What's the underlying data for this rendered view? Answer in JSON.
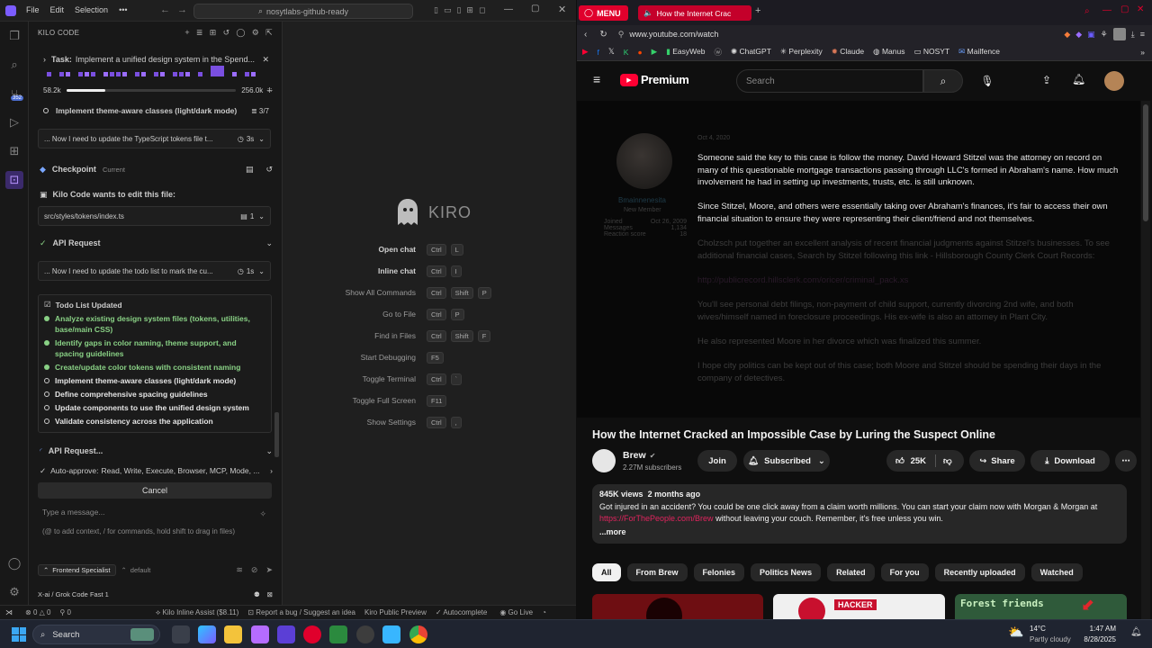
{
  "ide": {
    "menu": [
      "File",
      "Edit",
      "Selection"
    ],
    "search": "nosytlabs-github-ready",
    "panel_title": "KILO CODE",
    "task_label": "Task:",
    "task_text": "Implement a unified design system in the Spend...",
    "tokens_left": "58.2k",
    "tokens_right": "256.0k",
    "current_todo": "Implement theme-aware classes (light/dark mode)",
    "current_todo_count": "3/7",
    "thought1": "... Now I need to update the TypeScript tokens file t...",
    "thought1_time": "3s",
    "checkpoint_label": "Checkpoint",
    "checkpoint_status": "Current",
    "edit_heading": "Kilo Code wants to edit this file:",
    "edit_file": "src/styles/tokens/index.ts",
    "edit_count": "1",
    "api_request": "API Request",
    "thought2": "... Now I need to update the todo list to mark the cu...",
    "thought2_time": "1s",
    "todo_title": "Todo List Updated",
    "todos": [
      {
        "text": "Analyze existing design system files (tokens, utilities, base/main CSS)",
        "done": true
      },
      {
        "text": "Identify gaps in color naming, theme support, and spacing guidelines",
        "done": true
      },
      {
        "text": "Create/update color tokens with consistent naming",
        "done": true
      },
      {
        "text": "Implement theme-aware classes (light/dark mode)",
        "done": false
      },
      {
        "text": "Define comprehensive spacing guidelines",
        "done": false
      },
      {
        "text": "Update components to use the unified design system",
        "done": false
      },
      {
        "text": "Validate consistency across the application",
        "done": false
      }
    ],
    "api_request_pending": "API Request...",
    "auto_approve_label": "Auto-approve:",
    "auto_approve_list": "Read, Write, Execute, Browser, MCP, Mode, ...",
    "cancel": "Cancel",
    "message_placeholder": "Type a message...",
    "message_hint": "(@ to add context, / for commands, hold shift to drag in files)",
    "mode": "Frontend Specialist",
    "profile": "default",
    "model": "X-ai / Grok Code Fast 1",
    "brand": "KIRO",
    "shortcuts": [
      {
        "label": "Open chat",
        "keys": [
          "Ctrl",
          "L"
        ],
        "bold": true
      },
      {
        "label": "Inline chat",
        "keys": [
          "Ctrl",
          "I"
        ],
        "bold": true
      },
      {
        "label": "Show All Commands",
        "keys": [
          "Ctrl",
          "Shift",
          "P"
        ],
        "bold": false
      },
      {
        "label": "Go to File",
        "keys": [
          "Ctrl",
          "P"
        ],
        "bold": false
      },
      {
        "label": "Find in Files",
        "keys": [
          "Ctrl",
          "Shift",
          "F"
        ],
        "bold": false
      },
      {
        "label": "Start Debugging",
        "keys": [
          "F5"
        ],
        "bold": false
      },
      {
        "label": "Toggle Terminal",
        "keys": [
          "Ctrl",
          "`"
        ],
        "bold": false
      },
      {
        "label": "Toggle Full Screen",
        "keys": [
          "F11"
        ],
        "bold": false
      },
      {
        "label": "Show Settings",
        "keys": [
          "Ctrl",
          ","
        ],
        "bold": false
      }
    ],
    "status": {
      "errors": "0",
      "warnings": "0",
      "ports": "0",
      "kilo_assist": "Kilo Inline Assist ($8.11)",
      "report": "Report a bug / Suggest an idea",
      "kiro_preview": "Kiro Public Preview",
      "autocomplete": "Autocomplete",
      "go_live": "Go Live"
    },
    "badge": "352"
  },
  "browser": {
    "menu_label": "MENU",
    "tab_title": "How the Internet Crac",
    "url": "www.youtube.com/watch",
    "bookmarks": [
      "EasyWeb",
      "ChatGPT",
      "Perplexity",
      "Claude",
      "Manus",
      "NOSYT",
      "Mailfence"
    ],
    "yt_brand": "Premium",
    "search_placeholder": "Search",
    "comment": {
      "user": "Bmainnenesita",
      "role": "New Member",
      "date": "Oct 4, 2020",
      "joined_label": "Joined",
      "joined": "Oct 26, 2009",
      "messages_label": "Messages",
      "messages": "1,134",
      "reactions_label": "Reaction score",
      "reactions": "18",
      "p1": "Someone said the key to this case is follow the money. David Howard Stitzel was the attorney on record on many of this questionable mortgage transactions passing through LLC's formed in Abraham's name. How much involvement he had in setting up investments, trusts, etc. is still unknown.",
      "p2": "Since Stitzel, Moore, and others were essentially taking over Abraham's finances, it's fair to access their own financial situation to ensure they were representing their client/friend and not themselves.",
      "p3": "Cholzsch put together an excellent analysis of recent financial judgments against Stitzel's businesses. To see additional financial cases, Search by Stitzel following this link - Hillsborough County Clerk Court Records:",
      "p4": "http://publicrecord.hillsclerk.com/oricer/criminal_pack.xs",
      "p5": "You'll see personal debt filings, non-payment of child support, currently divorcing 2nd wife, and both wives/himself named in foreclosure proceedings. His ex-wife is also an attorney in Plant City.",
      "p6": "He also represented Moore in her divorce which was finalized this summer.",
      "p7": "I hope city politics can be kept out of this case; both Moore and Stitzel should be spending their days in the company of detectives."
    },
    "video_title": "How the Internet Cracked an Impossible Case by Luring the Suspect Online",
    "channel": "Brew",
    "subscribers": "2.27M subscribers",
    "join": "Join",
    "subscribed": "Subscribed",
    "likes": "25K",
    "share": "Share",
    "download": "Download",
    "views": "845K views",
    "age": "2 months ago",
    "desc1": "Got injured in an accident? You could be one click away from a claim worth millions. You can start your claim now with Morgan & Morgan at",
    "desc_link": "https://ForThePeople.com/Brew",
    "desc2": "without leaving your couch. Remember, it's free unless you win.",
    "more": "...more",
    "chips": [
      "All",
      "From Brew",
      "Felonies",
      "Politics News",
      "Related",
      "For you",
      "Recently uploaded",
      "Watched"
    ],
    "thumb2_label": "HACKER",
    "thumb3_label": "Forest friends"
  },
  "taskbar": {
    "search": "Search",
    "temp": "14°C",
    "weather": "Partly cloudy",
    "time": "1:47 AM",
    "date": "8/28/2025"
  },
  "colors": {
    "accent": "#8a4fff",
    "yt_red": "#ff0033",
    "done_green": "#89d185"
  }
}
